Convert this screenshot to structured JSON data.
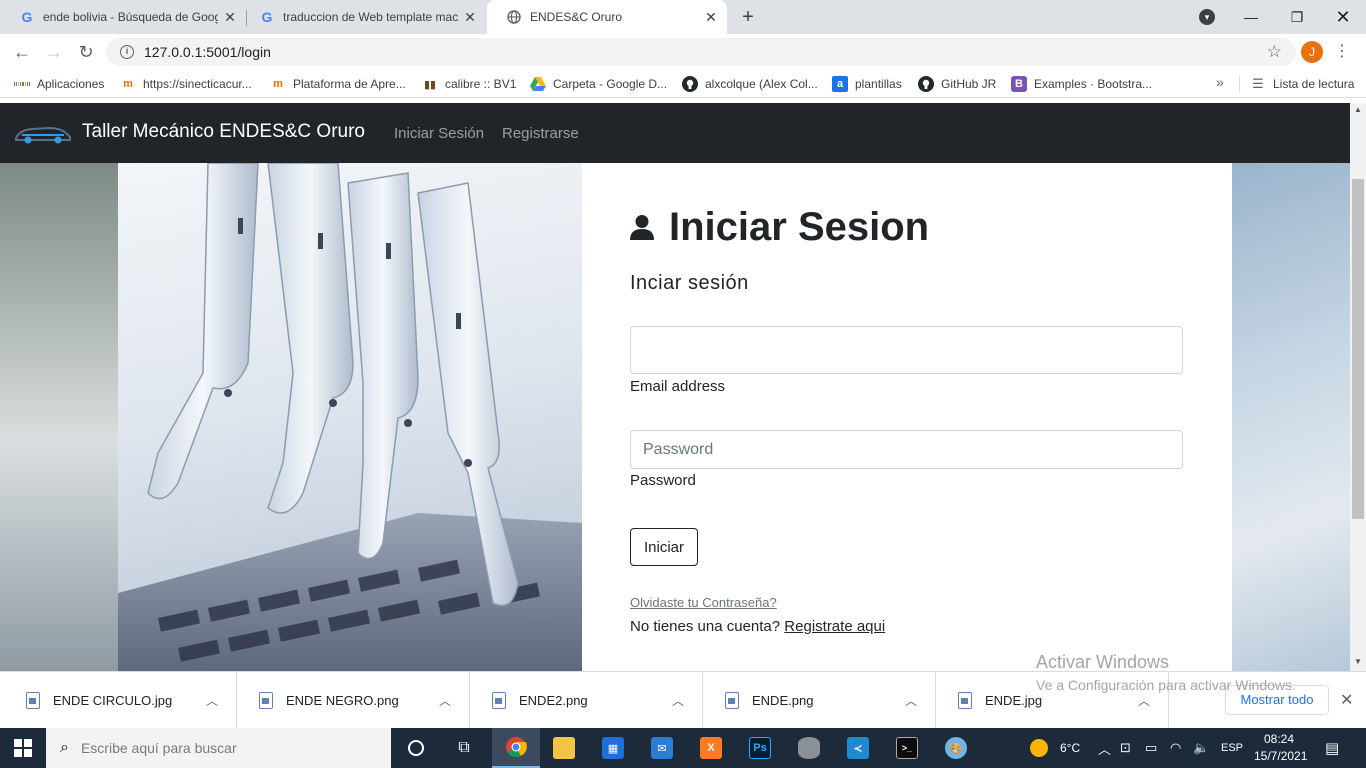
{
  "browser": {
    "tabs": [
      {
        "title": "ende bolivia - Búsqueda de Goog",
        "favicon": "G"
      },
      {
        "title": "traduccion de Web template mac",
        "favicon": "G"
      },
      {
        "title": "ENDES&C Oruro",
        "favicon": "globe"
      }
    ],
    "url": "127.0.0.1:5001/login",
    "profile_initial": "J",
    "bookmarks": [
      {
        "label": "Aplicaciones"
      },
      {
        "label": "https://sinecticacur..."
      },
      {
        "label": "Plataforma de Apre..."
      },
      {
        "label": "calibre :: BV1"
      },
      {
        "label": "Carpeta - Google D..."
      },
      {
        "label": "alxcolque (Alex Col..."
      },
      {
        "label": "plantillas"
      },
      {
        "label": "GitHub JR"
      },
      {
        "label": "Examples · Bootstra..."
      }
    ],
    "reading_list": "Lista de lectura"
  },
  "navbar": {
    "brand": "Taller Mecánico ENDES&C Oruro",
    "links": [
      "Iniciar Sesión",
      "Registrarse"
    ]
  },
  "login": {
    "title": "Iniciar Sesion",
    "subtitle": "Inciar sesión",
    "email_label": "Email address",
    "email_value": "",
    "password_placeholder": "Password",
    "password_label": "Password",
    "submit": "Iniciar",
    "forgot": "Olvidaste tu Contraseña?",
    "no_account": "No tienes una cuenta?",
    "register": "Registrate aqui"
  },
  "watermark": {
    "line1": "Activar Windows",
    "line2": "Ve a Configuración para activar Windows."
  },
  "downloads": {
    "files": [
      "ENDE CIRCULO.jpg",
      "ENDE NEGRO.png",
      "ENDE2.png",
      "ENDE.png",
      "ENDE.jpg"
    ],
    "show_all": "Mostrar todo"
  },
  "taskbar": {
    "search_placeholder": "Escribe aquí para buscar",
    "temperature": "6°C",
    "language": "ESP",
    "time": "08:24",
    "date": "15/7/2021"
  },
  "colors": {
    "navbar_bg": "#212529",
    "link": "#6c757d",
    "accent_blue": "#1a73e8",
    "taskbar_bg": "#1c2a3a"
  }
}
